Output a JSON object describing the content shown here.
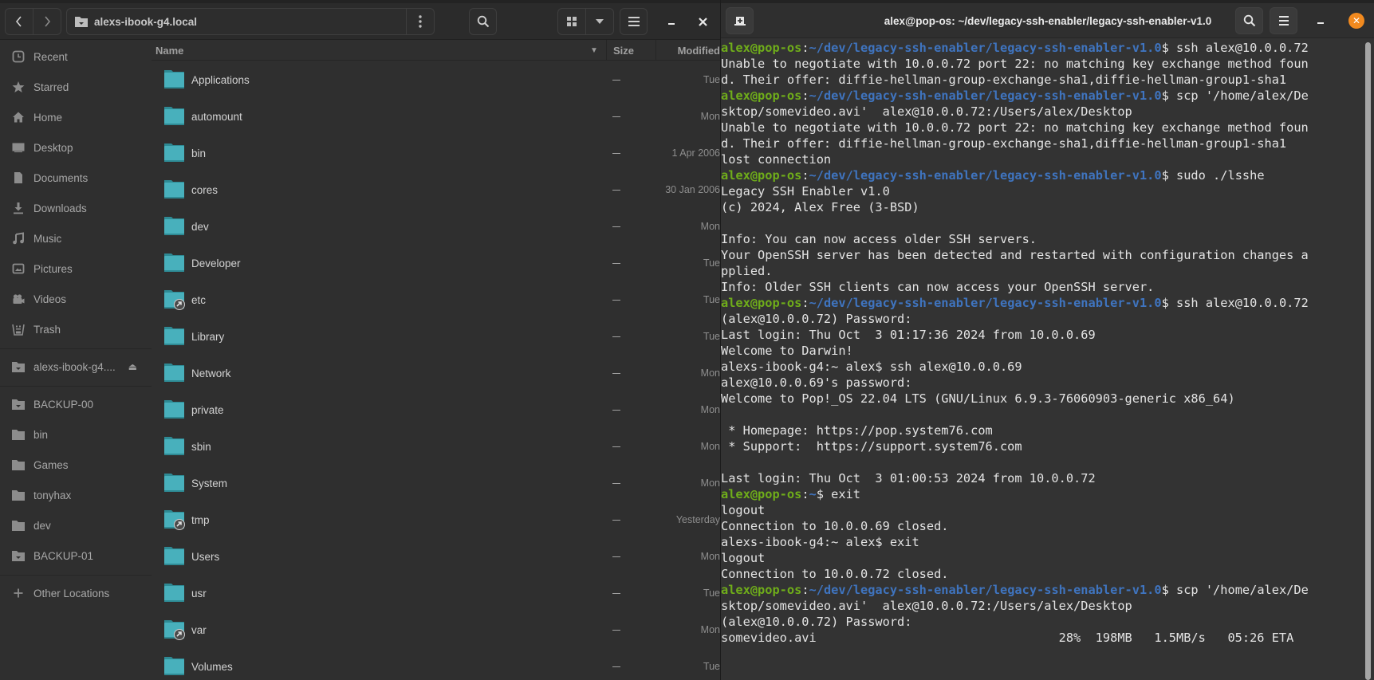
{
  "file_manager": {
    "location": "alexs-ibook-g4.local",
    "icons": {
      "back": "chevron-left-icon",
      "forward": "chevron-right-icon",
      "location": "network-folder-icon",
      "more": "vertical-dots-icon",
      "search": "search-icon",
      "view": "grid-view-icon",
      "view_options": "chevron-down-icon",
      "menu": "hamburger-menu-icon",
      "minimize": "minimize-icon",
      "close": "close-icon"
    },
    "sidebar": {
      "places": [
        {
          "label": "Recent",
          "icon": "recent-clock-icon"
        },
        {
          "label": "Starred",
          "icon": "star-icon"
        },
        {
          "label": "Home",
          "icon": "home-icon"
        },
        {
          "label": "Desktop",
          "icon": "desktop-icon"
        },
        {
          "label": "Documents",
          "icon": "document-icon"
        },
        {
          "label": "Downloads",
          "icon": "download-icon"
        },
        {
          "label": "Music",
          "icon": "music-icon"
        },
        {
          "label": "Pictures",
          "icon": "picture-icon"
        },
        {
          "label": "Videos",
          "icon": "video-icon"
        },
        {
          "label": "Trash",
          "icon": "trash-icon"
        }
      ],
      "mounts": [
        {
          "label": "alexs-ibook-g4....",
          "icon": "network-folder-icon",
          "eject": true
        }
      ],
      "bookmarks": [
        {
          "label": "BACKUP-00",
          "icon": "network-folder-icon"
        },
        {
          "label": "bin",
          "icon": "folder-icon"
        },
        {
          "label": "Games",
          "icon": "folder-icon"
        },
        {
          "label": "tonyhax",
          "icon": "folder-icon"
        },
        {
          "label": "dev",
          "icon": "folder-icon"
        },
        {
          "label": "BACKUP-01",
          "icon": "network-folder-icon"
        }
      ],
      "other_locations": {
        "label": "Other Locations",
        "icon": "plus-icon"
      }
    },
    "columns": {
      "name": "Name",
      "size": "Size",
      "modified": "Modified"
    },
    "files": [
      {
        "name": "Applications",
        "size": "—",
        "modified": "Tue",
        "symlink": false
      },
      {
        "name": "automount",
        "size": "—",
        "modified": "Mon",
        "symlink": false
      },
      {
        "name": "bin",
        "size": "—",
        "modified": "1 Apr 2006",
        "symlink": false
      },
      {
        "name": "cores",
        "size": "—",
        "modified": "30 Jan 2006",
        "symlink": false
      },
      {
        "name": "dev",
        "size": "—",
        "modified": "Mon",
        "symlink": false
      },
      {
        "name": "Developer",
        "size": "—",
        "modified": "Tue",
        "symlink": false
      },
      {
        "name": "etc",
        "size": "—",
        "modified": "Tue",
        "symlink": true
      },
      {
        "name": "Library",
        "size": "—",
        "modified": "Tue",
        "symlink": false
      },
      {
        "name": "Network",
        "size": "—",
        "modified": "Mon",
        "symlink": false
      },
      {
        "name": "private",
        "size": "—",
        "modified": "Mon",
        "symlink": false
      },
      {
        "name": "sbin",
        "size": "—",
        "modified": "Mon",
        "symlink": false
      },
      {
        "name": "System",
        "size": "—",
        "modified": "Mon",
        "symlink": false
      },
      {
        "name": "tmp",
        "size": "—",
        "modified": "Yesterday",
        "symlink": true
      },
      {
        "name": "Users",
        "size": "—",
        "modified": "Mon",
        "symlink": false
      },
      {
        "name": "usr",
        "size": "—",
        "modified": "Tue",
        "symlink": false
      },
      {
        "name": "var",
        "size": "—",
        "modified": "Mon",
        "symlink": true
      },
      {
        "name": "Volumes",
        "size": "—",
        "modified": "Tue",
        "symlink": false
      }
    ],
    "colors": {
      "folder": "#48b0bc",
      "folder_tab": "#2e8a94",
      "background": "#2f2f2f"
    }
  },
  "terminal": {
    "title": "alex@pop-os: ~/dev/legacy-ssh-enabler/legacy-ssh-enabler-v1.0",
    "icons": {
      "new_tab": "new-tab-icon",
      "search": "search-icon",
      "menu": "hamburger-menu-icon",
      "minimize": "minimize-icon",
      "close": "close-icon"
    },
    "colors": {
      "user": "#6fad1a",
      "path": "#3f74bf",
      "close": "#f28a1f",
      "text": "#e4e4e4"
    },
    "lines": [
      {
        "user": "alex@pop-os",
        "path": "~/dev/legacy-ssh-enabler/legacy-ssh-enabler-v1.0",
        "cmd": "$ ssh alex@10.0.0.72"
      },
      {
        "text": "Unable to negotiate with 10.0.0.72 port 22: no matching key exchange method foun"
      },
      {
        "text": "d. Their offer: diffie-hellman-group-exchange-sha1,diffie-hellman-group1-sha1"
      },
      {
        "user": "alex@pop-os",
        "path": "~/dev/legacy-ssh-enabler/legacy-ssh-enabler-v1.0",
        "cmd": "$ scp '/home/alex/De"
      },
      {
        "text": "sktop/somevideo.avi'  alex@10.0.0.72:/Users/alex/Desktop"
      },
      {
        "text": "Unable to negotiate with 10.0.0.72 port 22: no matching key exchange method foun"
      },
      {
        "text": "d. Their offer: diffie-hellman-group-exchange-sha1,diffie-hellman-group1-sha1"
      },
      {
        "text": "lost connection"
      },
      {
        "user": "alex@pop-os",
        "path": "~/dev/legacy-ssh-enabler/legacy-ssh-enabler-v1.0",
        "cmd": "$ sudo ./lsshe"
      },
      {
        "text": "Legacy SSH Enabler v1.0"
      },
      {
        "text": "(c) 2024, Alex Free (3-BSD)"
      },
      {
        "text": ""
      },
      {
        "text": "Info: You can now access older SSH servers."
      },
      {
        "text": "Your OpenSSH server has been detected and restarted with configuration changes a"
      },
      {
        "text": "pplied."
      },
      {
        "text": "Info: Older SSH clients can now access your OpenSSH server."
      },
      {
        "user": "alex@pop-os",
        "path": "~/dev/legacy-ssh-enabler/legacy-ssh-enabler-v1.0",
        "cmd": "$ ssh alex@10.0.0.72"
      },
      {
        "text": "(alex@10.0.0.72) Password:"
      },
      {
        "text": "Last login: Thu Oct  3 01:17:36 2024 from 10.0.0.69"
      },
      {
        "text": "Welcome to Darwin!"
      },
      {
        "text": "alexs-ibook-g4:~ alex$ ssh alex@10.0.0.69"
      },
      {
        "text": "alex@10.0.0.69's password:"
      },
      {
        "text": "Welcome to Pop!_OS 22.04 LTS (GNU/Linux 6.9.3-76060903-generic x86_64)"
      },
      {
        "text": ""
      },
      {
        "text": " * Homepage: https://pop.system76.com"
      },
      {
        "text": " * Support:  https://support.system76.com"
      },
      {
        "text": ""
      },
      {
        "text": "Last login: Thu Oct  3 01:00:53 2024 from 10.0.0.72"
      },
      {
        "user": "alex@pop-os",
        "path": "~",
        "cmd": "$ exit"
      },
      {
        "text": "logout"
      },
      {
        "text": "Connection to 10.0.0.69 closed."
      },
      {
        "text": "alexs-ibook-g4:~ alex$ exit"
      },
      {
        "text": "logout"
      },
      {
        "text": "Connection to 10.0.0.72 closed."
      },
      {
        "user": "alex@pop-os",
        "path": "~/dev/legacy-ssh-enabler/legacy-ssh-enabler-v1.0",
        "cmd": "$ scp '/home/alex/De"
      },
      {
        "text": "sktop/somevideo.avi'  alex@10.0.0.72:/Users/alex/Desktop"
      },
      {
        "text": "(alex@10.0.0.72) Password:"
      },
      {
        "text": "somevideo.avi                                 28%  198MB   1.5MB/s   05:26 ETA"
      }
    ],
    "transfer": {
      "file": "somevideo.avi",
      "percent": 28,
      "transferred": "198MB",
      "rate": "1.5MB/s",
      "eta": "05:26 ETA"
    }
  }
}
